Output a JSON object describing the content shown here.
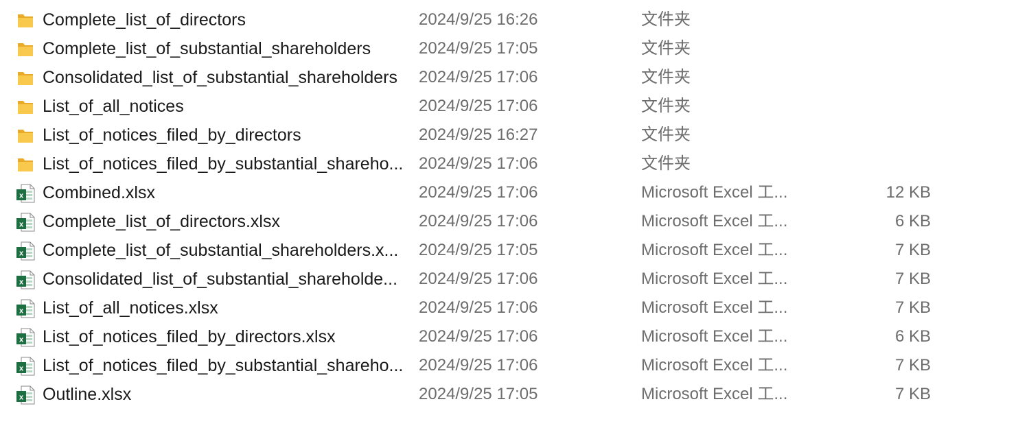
{
  "files": [
    {
      "name": "Complete_list_of_directors",
      "date": "2024/9/25 16:26",
      "type": "文件夹",
      "size": "",
      "icon": "folder-icon"
    },
    {
      "name": "Complete_list_of_substantial_shareholders",
      "date": "2024/9/25 17:05",
      "type": "文件夹",
      "size": "",
      "icon": "folder-icon"
    },
    {
      "name": "Consolidated_list_of_substantial_shareholders",
      "date": "2024/9/25 17:06",
      "type": "文件夹",
      "size": "",
      "icon": "folder-icon"
    },
    {
      "name": "List_of_all_notices",
      "date": "2024/9/25 17:06",
      "type": "文件夹",
      "size": "",
      "icon": "folder-icon"
    },
    {
      "name": "List_of_notices_filed_by_directors",
      "date": "2024/9/25 16:27",
      "type": "文件夹",
      "size": "",
      "icon": "folder-icon"
    },
    {
      "name": "List_of_notices_filed_by_substantial_shareho...",
      "date": "2024/9/25 17:06",
      "type": "文件夹",
      "size": "",
      "icon": "folder-icon"
    },
    {
      "name": "Combined.xlsx",
      "date": "2024/9/25 17:06",
      "type": "Microsoft Excel 工...",
      "size": "12 KB",
      "icon": "excel-file-icon"
    },
    {
      "name": "Complete_list_of_directors.xlsx",
      "date": "2024/9/25 17:06",
      "type": "Microsoft Excel 工...",
      "size": "6 KB",
      "icon": "excel-file-icon"
    },
    {
      "name": "Complete_list_of_substantial_shareholders.x...",
      "date": "2024/9/25 17:05",
      "type": "Microsoft Excel 工...",
      "size": "7 KB",
      "icon": "excel-file-icon"
    },
    {
      "name": "Consolidated_list_of_substantial_shareholde...",
      "date": "2024/9/25 17:06",
      "type": "Microsoft Excel 工...",
      "size": "7 KB",
      "icon": "excel-file-icon"
    },
    {
      "name": "List_of_all_notices.xlsx",
      "date": "2024/9/25 17:06",
      "type": "Microsoft Excel 工...",
      "size": "7 KB",
      "icon": "excel-file-icon"
    },
    {
      "name": "List_of_notices_filed_by_directors.xlsx",
      "date": "2024/9/25 17:06",
      "type": "Microsoft Excel 工...",
      "size": "6 KB",
      "icon": "excel-file-icon"
    },
    {
      "name": "List_of_notices_filed_by_substantial_shareho...",
      "date": "2024/9/25 17:06",
      "type": "Microsoft Excel 工...",
      "size": "7 KB",
      "icon": "excel-file-icon"
    },
    {
      "name": "Outline.xlsx",
      "date": "2024/9/25 17:05",
      "type": "Microsoft Excel 工...",
      "size": "7 KB",
      "icon": "excel-file-icon"
    }
  ],
  "colors": {
    "folder": "#f8c94c",
    "folder_back": "#e8aa2a",
    "excel": "#1d6f42",
    "name_text": "#1a1a1a",
    "meta_text": "#6d6d6d"
  }
}
